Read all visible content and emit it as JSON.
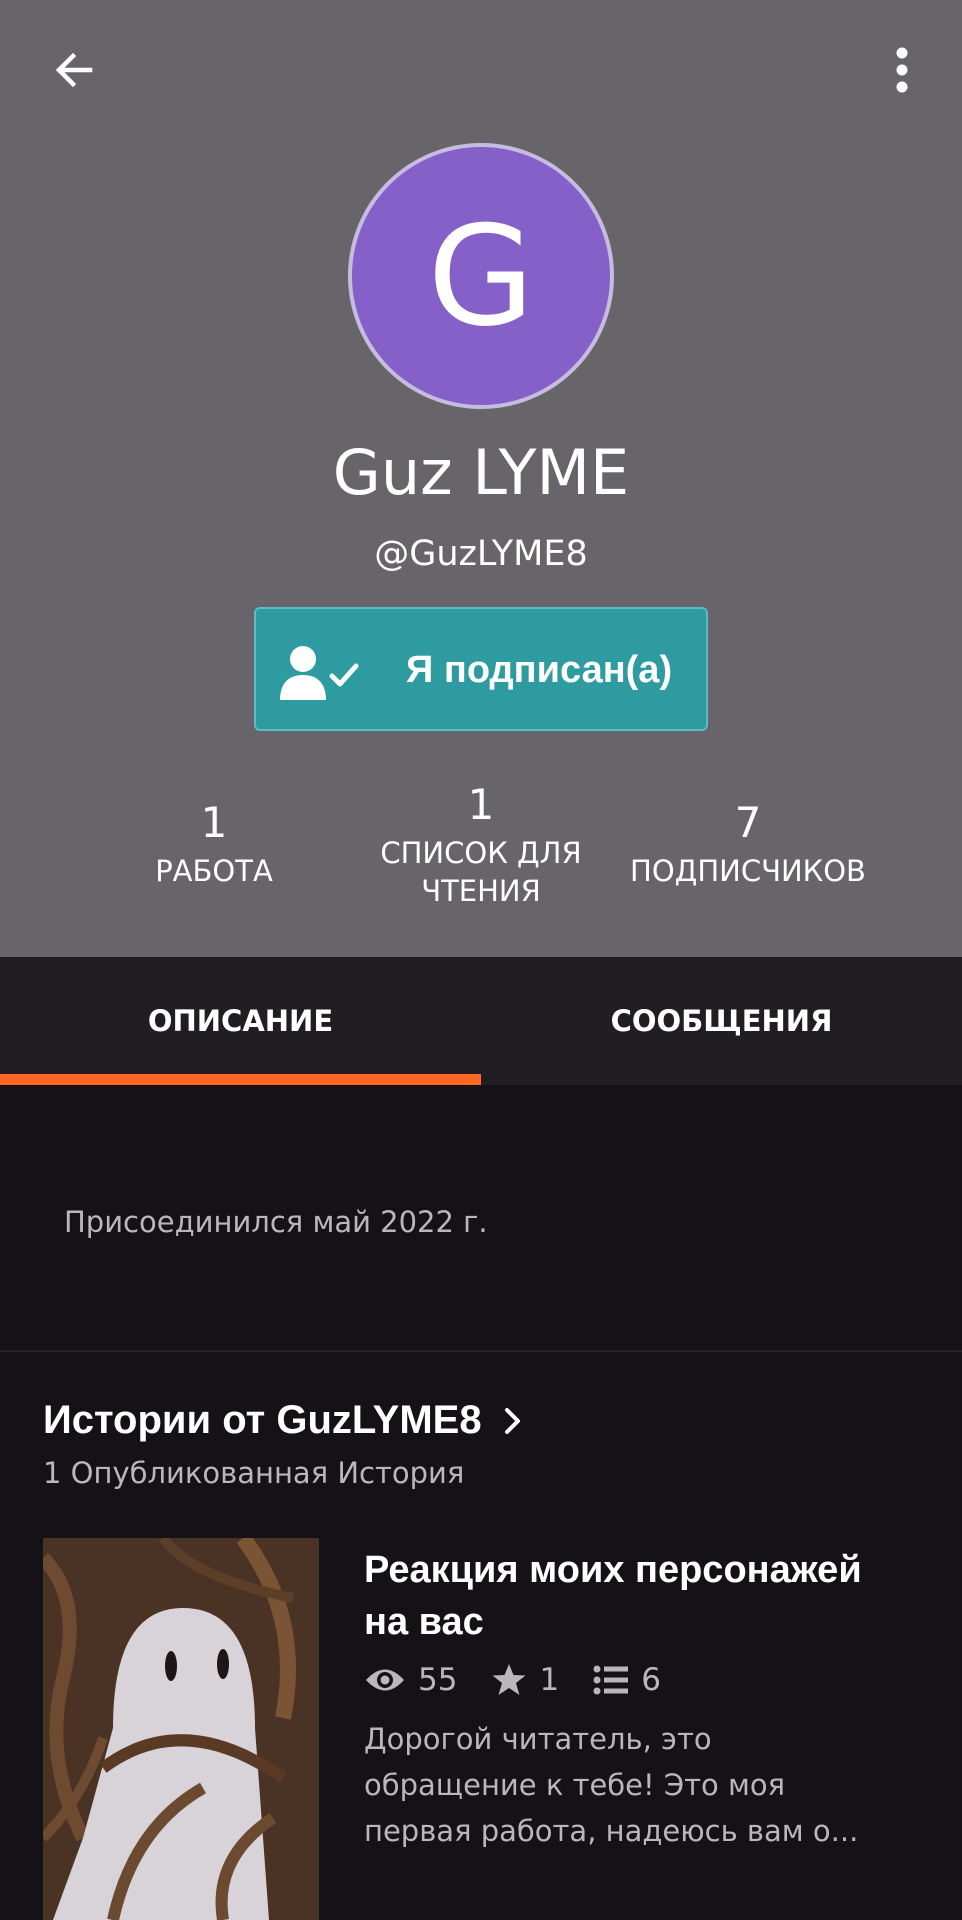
{
  "header": {
    "avatar_letter": "G",
    "display_name": "Guz LYME",
    "username": "@GuzLYME8",
    "follow_label": "Я подписан(а)"
  },
  "stats": [
    {
      "value": "1",
      "label": "РАБОТА"
    },
    {
      "value": "1",
      "label_line1": "СПИСОК ДЛЯ",
      "label_line2": "ЧТЕНИЯ"
    },
    {
      "value": "7",
      "label": "ПОДПИСЧИКОВ"
    }
  ],
  "tabs": [
    {
      "label": "ОПИСАНИЕ",
      "active": true
    },
    {
      "label": "СООБЩЕНИЯ",
      "active": false
    }
  ],
  "about": {
    "joined": "Присоединился май 2022 г."
  },
  "stories": {
    "title": "Истории от GuzLYME8",
    "subtitle": "1 Опубликованная История",
    "items": [
      {
        "title": "Реакция моих персонажей на вас",
        "views": "55",
        "votes": "1",
        "parts": "6",
        "description": "Дорогой читатель, это обращение к тебе! Это моя первая работа, надеюсь вам о..."
      }
    ]
  },
  "colors": {
    "header_bg": "#676569",
    "avatar_bg": "#8460c8",
    "follow_button": "#2e9ba0",
    "tab_indicator": "#ff6723",
    "page_bg": "#141216"
  }
}
